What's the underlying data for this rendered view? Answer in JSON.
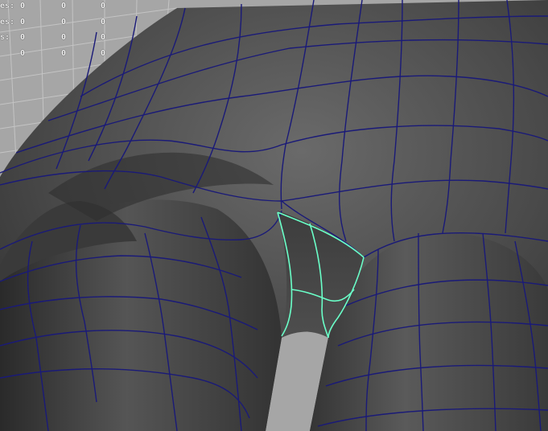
{
  "viewport": {
    "grid_color": "#c8c8c8",
    "mesh_color": "#3c3c3c",
    "wire_color": "#1a1a78",
    "selected_edge_color": "#6affc8",
    "background_color": "#a6a6a6"
  },
  "hud": {
    "rows": [
      {
        "label": "es:",
        "values": [
          "0",
          "0",
          "0"
        ]
      },
      {
        "label": "es:",
        "values": [
          "0",
          "0",
          "0"
        ]
      },
      {
        "label": "s:",
        "values": [
          "0",
          "0",
          "0"
        ]
      },
      {
        "label": "",
        "values": [
          "0",
          "0",
          "0"
        ]
      }
    ]
  }
}
